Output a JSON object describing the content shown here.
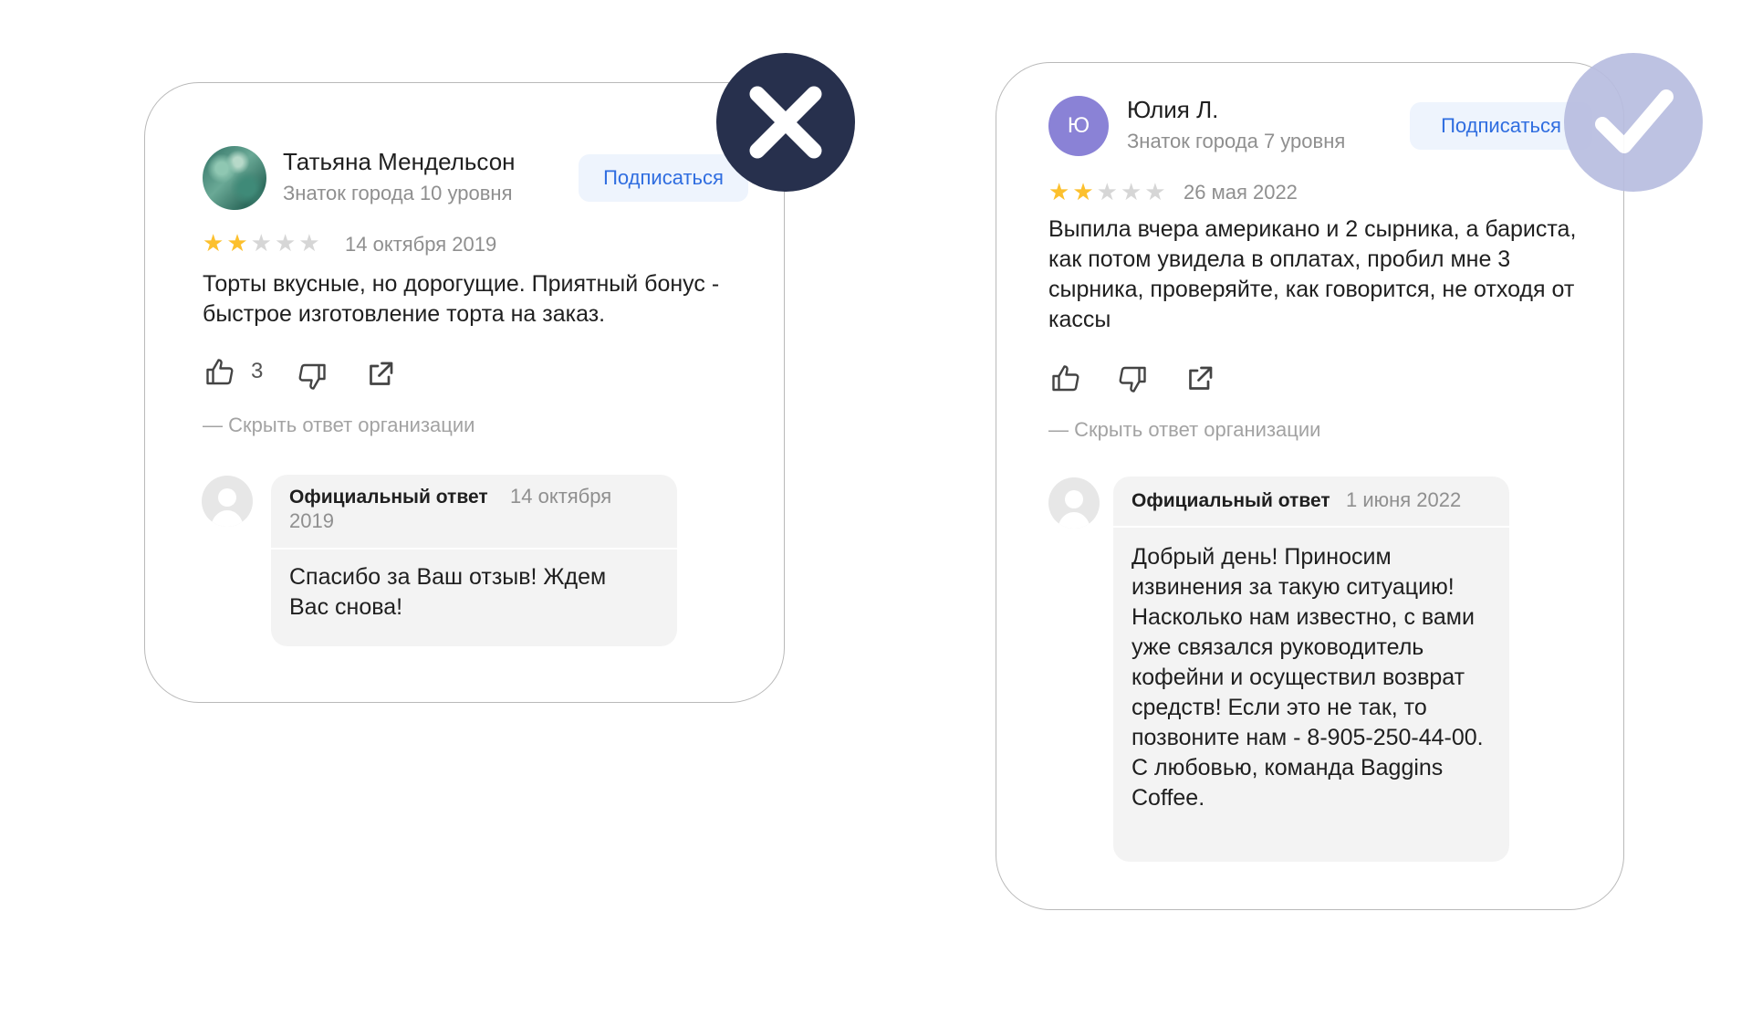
{
  "left_review": {
    "author_name": "Татьяна Мендельсон",
    "author_level": "Знаток города 10 уровня",
    "subscribe_label": "Подписаться",
    "rating": 2,
    "rating_max": 5,
    "date": "14 октября 2019",
    "text": "Торты вкусные, но дорогущие. Приятный бонус - быстрое изготовление торта на заказ.",
    "like_count": "3",
    "hide_reply_label": "— Скрыть ответ организации",
    "reply": {
      "title": "Официальный ответ",
      "date_line1": "14 октября",
      "date_line2": "2019",
      "text": "Спасибо за Ваш отзыв! Ждем Вас снова!"
    },
    "verdict_icon": "cross-icon"
  },
  "right_review": {
    "avatar_letter": "Ю",
    "author_name": "Юлия Л.",
    "author_level": "Знаток города 7 уровня",
    "subscribe_label": "Подписаться",
    "rating": 2,
    "rating_max": 5,
    "date": "26 мая 2022",
    "text": "Выпила вчера американо и 2 сырника, а бариста, как потом увидела в оплатах, пробил мне 3 сырника, проверяйте, как говорится, не отходя от кассы",
    "hide_reply_label": "— Скрыть ответ организации",
    "reply": {
      "title": "Официальный ответ",
      "date": "1 июня 2022",
      "text": "Добрый день! Приносим извинения за такую ситуацию! Насколько нам известно, с вами уже связался руководитель кофейни и осуществил возврат средств! Если это не так, то позвоните нам - 8-905-250-44-00. С любовью, команда Baggins Coffee."
    },
    "verdict_icon": "checkmark-icon"
  },
  "colors": {
    "accent_blue": "#2f6de0",
    "star_on": "#fcc02d",
    "star_off": "#d6d6d6",
    "badge_bad": "#27304d",
    "badge_good": "#b8bde0",
    "avatar_purple": "#8a82d6"
  }
}
